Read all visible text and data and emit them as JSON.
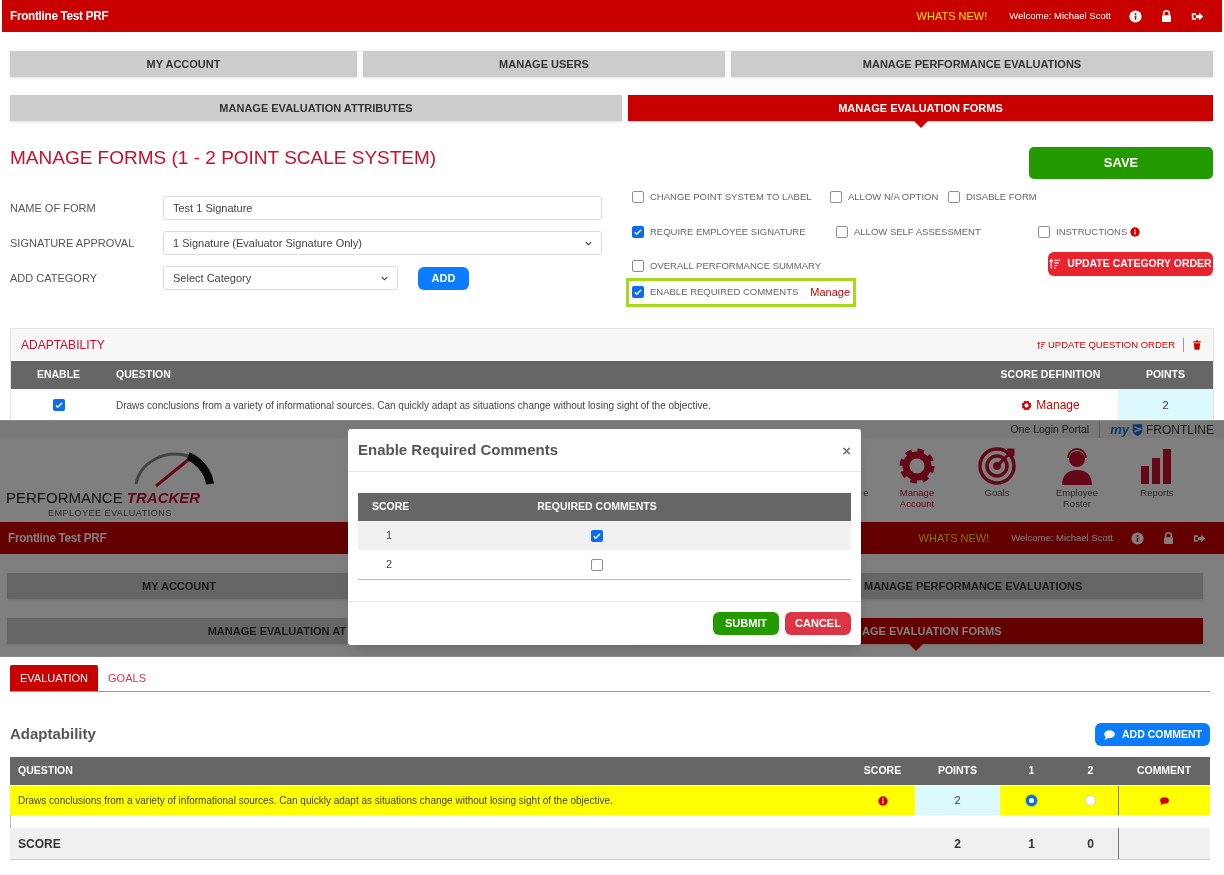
{
  "app_bar": {
    "title": "Frontline Test PRF",
    "whats_new": "WHATS NEW!",
    "welcome": "Welcome: Michael Scott"
  },
  "nav_rows": [
    [
      {
        "label": "MY ACCOUNT",
        "selected": false
      },
      {
        "label": "MANAGE USERS",
        "selected": false
      },
      {
        "label": "MANAGE PERFORMANCE EVALUATIONS",
        "selected": false
      }
    ],
    [
      {
        "label": "MANAGE EVALUATION ATTRIBUTES",
        "selected": false
      },
      {
        "label": "MANAGE EVALUATION FORMS",
        "selected": true
      }
    ]
  ],
  "page_title": "MANAGE FORMS (1 - 2 POINT SCALE SYSTEM)",
  "save_button": "SAVE",
  "fields": [
    {
      "kind": "text",
      "label": "NAME OF FORM",
      "value": "Test 1 Signature"
    },
    {
      "kind": "select",
      "label": "SIGNATURE APPROVAL",
      "value": "1 Signature (Evaluator Signature Only)"
    },
    {
      "kind": "select_add",
      "label": "ADD CATEGORY",
      "value": "Select Category",
      "button": "ADD"
    }
  ],
  "options": [
    [
      {
        "label": "CHANGE POINT SYSTEM TO LABEL",
        "checked": false
      },
      {
        "label": "ALLOW N/A OPTION",
        "checked": false
      },
      {
        "label": "DISABLE FORM",
        "checked": false
      }
    ],
    [
      {
        "label": "REQUIRE EMPLOYEE SIGNATURE",
        "checked": true
      },
      {
        "label": "ALLOW SELF ASSESSMENT",
        "checked": false
      },
      {
        "label": "INSTRUCTIONS",
        "checked": false,
        "info": true
      }
    ],
    [
      {
        "label": "OVERALL PERFORMANCE SUMMARY",
        "checked": false
      }
    ],
    [
      {
        "label": "ENABLE REQUIRED COMMENTS",
        "checked": true,
        "highlighted": true,
        "link": "Manage"
      }
    ]
  ],
  "update_category_order": "UPDATE CATEGORY ORDER",
  "category": {
    "name": "ADAPTABILITY",
    "update_question_order": "UPDATE QUESTION ORDER",
    "columns": [
      "ENABLE",
      "QUESTION",
      "SCORE DEFINITION",
      "POINTS"
    ],
    "rows": [
      {
        "enabled": true,
        "question": "Draws conclusions from a variety of informational sources. Can quickly adapt as situations change without losing sight of the objective.",
        "score_definition": "Manage",
        "points": "2"
      }
    ]
  },
  "second_screen": {
    "one_login": "One Login Portal",
    "frontline_logo": {
      "prefix": "my",
      "name": "FRONTLINE"
    },
    "logo": {
      "word_1": "PERFORMANCE",
      "word_2": "TRACKER",
      "tagline": "EMPLOYEE EVALUATIONS"
    },
    "nav_icons": [
      {
        "kind": "cut",
        "label": "e",
        "selected": false
      },
      {
        "kind": "gear",
        "label": "Manage Account",
        "selected": true
      },
      {
        "kind": "target",
        "label": "Goals",
        "selected": false
      },
      {
        "kind": "person",
        "label": "Employee Roster",
        "selected": false
      },
      {
        "kind": "chart",
        "label": "Reports",
        "selected": false
      }
    ],
    "app_bar": {
      "title": "Frontline Test PRF",
      "whats_new": "WHATS NEW!",
      "welcome": "Welcome: Michael Scott"
    },
    "nav_rows": [
      [
        {
          "label": "MY ACCOUNT",
          "selected": false
        },
        {
          "label": "MANAGE PERFORMANCE EVALUATIONS",
          "selected": false
        }
      ],
      [
        {
          "label": "MANAGE EVALUATION AT",
          "selected": false
        },
        {
          "label": "AGE EVALUATION FORMS",
          "selected": true
        }
      ]
    ],
    "modal": {
      "title": "Enable Required Comments",
      "close": "×",
      "columns": [
        "SCORE",
        "REQUIRED COMMENTS"
      ],
      "rows": [
        {
          "score": "1",
          "required": true
        },
        {
          "score": "2",
          "required": false
        }
      ],
      "submit": "SUBMIT",
      "cancel": "CANCEL"
    }
  },
  "third_screen": {
    "tabs": [
      {
        "label": "EVALUATION",
        "selected": true
      },
      {
        "label": "GOALS",
        "selected": false
      }
    ],
    "section_title": "Adaptability",
    "add_comment": "ADD COMMENT",
    "columns": [
      "QUESTION",
      "SCORE",
      "POINTS",
      "1",
      "2",
      "COMMENT"
    ],
    "rows": [
      {
        "question": "Draws conclusions from a variety of informational sources. Can quickly adapt as situations change without losing sight of the objective.",
        "points": "2",
        "choices": [
          {
            "selected": true
          },
          {
            "selected": false
          }
        ]
      }
    ],
    "total": {
      "label": "SCORE",
      "points": "2",
      "choice_1": "1",
      "choice_2": "0"
    }
  }
}
